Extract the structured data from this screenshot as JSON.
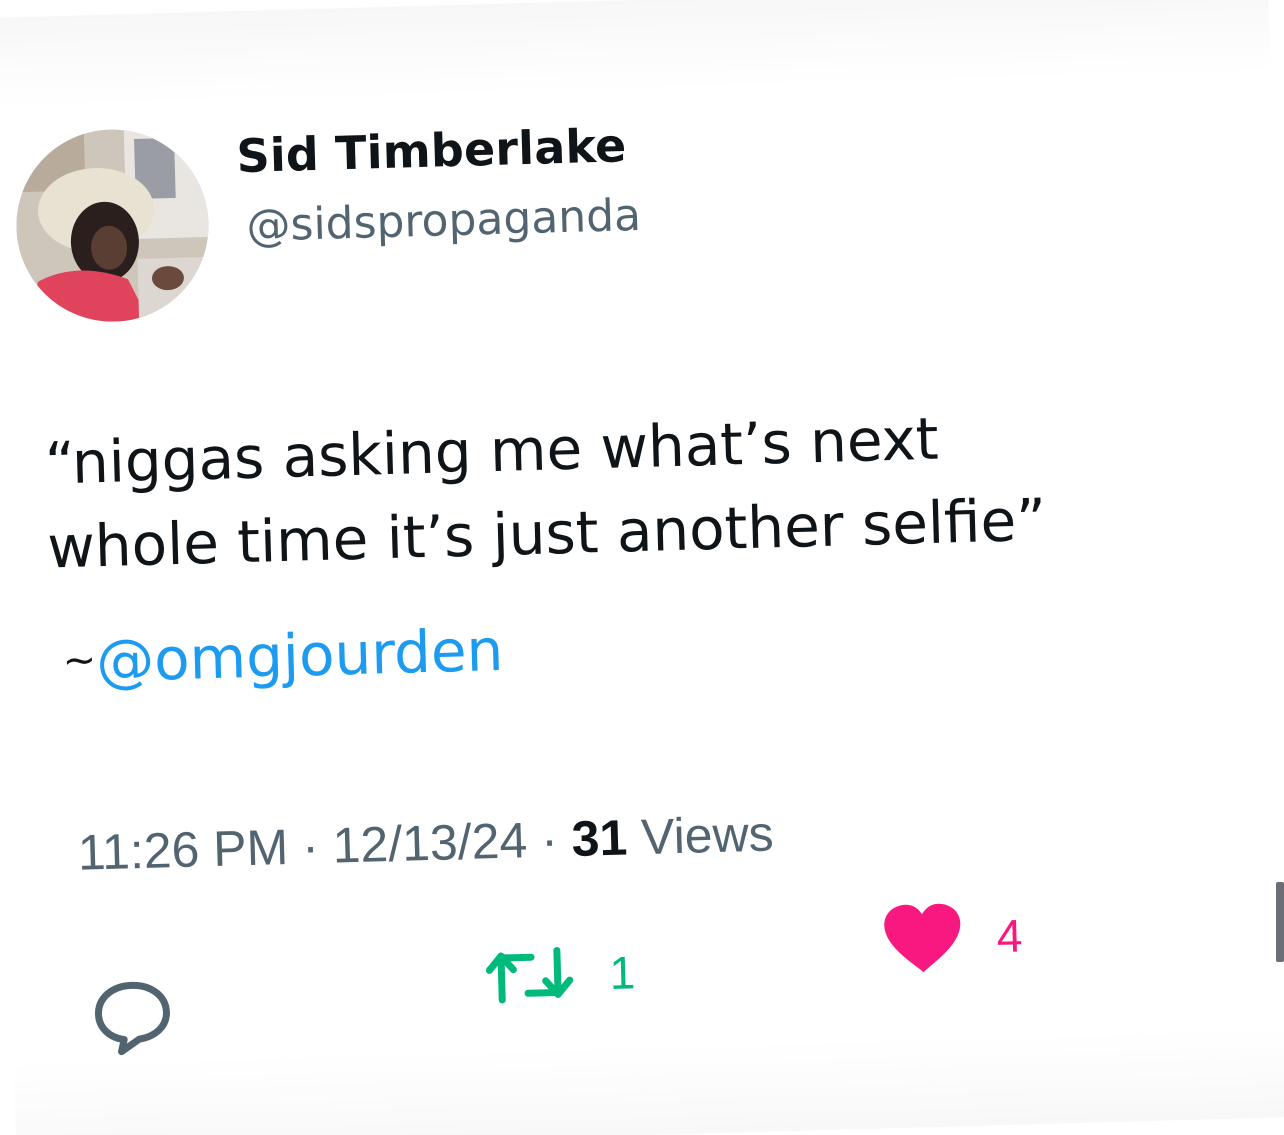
{
  "author": {
    "display_name": "Sid Timberlake",
    "handle": "@sidspropaganda",
    "avatar_icon": "profile-photo"
  },
  "tweet": {
    "lines": [
      "“niggas asking me what’s next",
      "whole time it’s just another selfie”"
    ],
    "credit_prefix": "~",
    "credit_mention": "@omgjourden",
    "mention_color": "#1d9bf0"
  },
  "meta": {
    "time": "11:26 PM",
    "separator": "·",
    "date": "12/13/24",
    "views_count": "31",
    "views_label": "Views"
  },
  "actions": {
    "reply": {
      "icon": "reply-icon",
      "count": ""
    },
    "retweet": {
      "icon": "retweet-icon",
      "count": "1",
      "color": "#00ba7c"
    },
    "like": {
      "icon": "heart-icon",
      "count": "4",
      "color": "#f91880"
    }
  }
}
